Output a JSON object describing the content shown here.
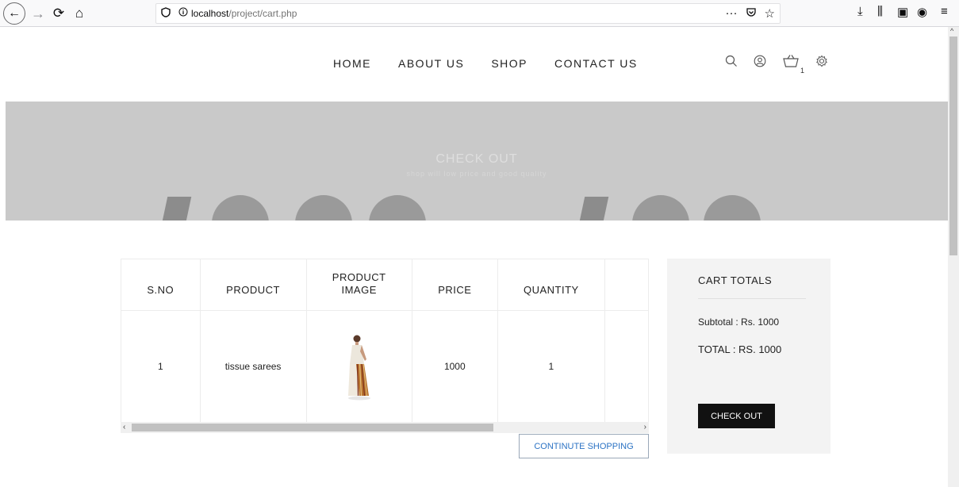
{
  "browser": {
    "back": "←",
    "forward": "→",
    "reload": "⟳",
    "home": "⌂",
    "url_host": "localhost",
    "url_path": "/project/cart.php",
    "page_actions": "···",
    "pocket": "♡",
    "bookmark": "☆",
    "download": "⤓",
    "library": "⫼",
    "sidebar": "▣",
    "account": "◉",
    "menu": "≡"
  },
  "nav": {
    "items": [
      "HOME",
      "ABOUT US",
      "SHOP",
      "CONTACT US"
    ]
  },
  "header": {
    "cart_count": "1"
  },
  "banner": {
    "title": "CHECK OUT",
    "subtitle": "shop will low price and good quality"
  },
  "cart_table": {
    "headers": [
      "S.NO",
      "PRODUCT",
      "PRODUCT IMAGE",
      "PRICE",
      "QUANTITY",
      ""
    ],
    "rows": [
      {
        "sno": "1",
        "product": "tissue sarees",
        "price": "1000",
        "quantity": "1"
      }
    ]
  },
  "continue_label": "CONTINUTE SHOPPING",
  "totals": {
    "title": "CART TOTALS",
    "subtotal": "Subtotal : Rs. 1000",
    "total": "TOTAL : RS. 1000",
    "checkout_label": "CHECK OUT"
  }
}
